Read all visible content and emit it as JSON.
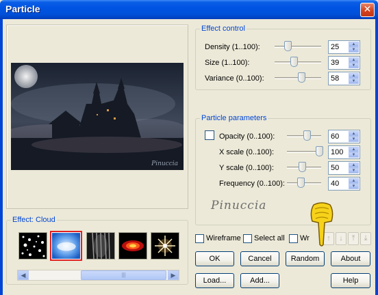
{
  "window": {
    "title": "Particle"
  },
  "effect_group": {
    "legend": "Effect: Cloud",
    "thumbnails": [
      {
        "name": "stars-thumbnail",
        "selected": false
      },
      {
        "name": "cloud-thumbnail",
        "selected": true
      },
      {
        "name": "rain-thumbnail",
        "selected": false
      },
      {
        "name": "fire-thumbnail",
        "selected": false
      },
      {
        "name": "sparkle-thumbnail",
        "selected": false
      }
    ],
    "scroll_left": "◀",
    "scroll_right": "▶",
    "scroll_grip": "|||"
  },
  "effect_control": {
    "legend": "Effect control",
    "rows": [
      {
        "label": "Density (1..100):",
        "value": "25"
      },
      {
        "label": "Size (1..100):",
        "value": "39"
      },
      {
        "label": "Variance (0..100):",
        "value": "58"
      }
    ]
  },
  "particle_parameters": {
    "legend": "Particle parameters",
    "rows": [
      {
        "label": "Opacity (0..100):",
        "value": "60"
      },
      {
        "label": "X scale (0..100):",
        "value": "100"
      },
      {
        "label": "Y scale (0..100):",
        "value": "50"
      },
      {
        "label": "Frequency (0..100):",
        "value": "40"
      }
    ],
    "signature": "Pinuccia"
  },
  "options": {
    "wireframe": "Wireframe",
    "select_all": "Select all",
    "wr": "Wr"
  },
  "buttons": {
    "ok": "OK",
    "cancel": "Cancel",
    "random": "Random",
    "about": "About",
    "load": "Load...",
    "add": "Add...",
    "help": "Help"
  },
  "preview": {
    "watermark": "Pinuccia"
  },
  "colors": {
    "accent": "#0046d5",
    "title_bar": "#0054e3",
    "selected_border": "#e02020"
  }
}
